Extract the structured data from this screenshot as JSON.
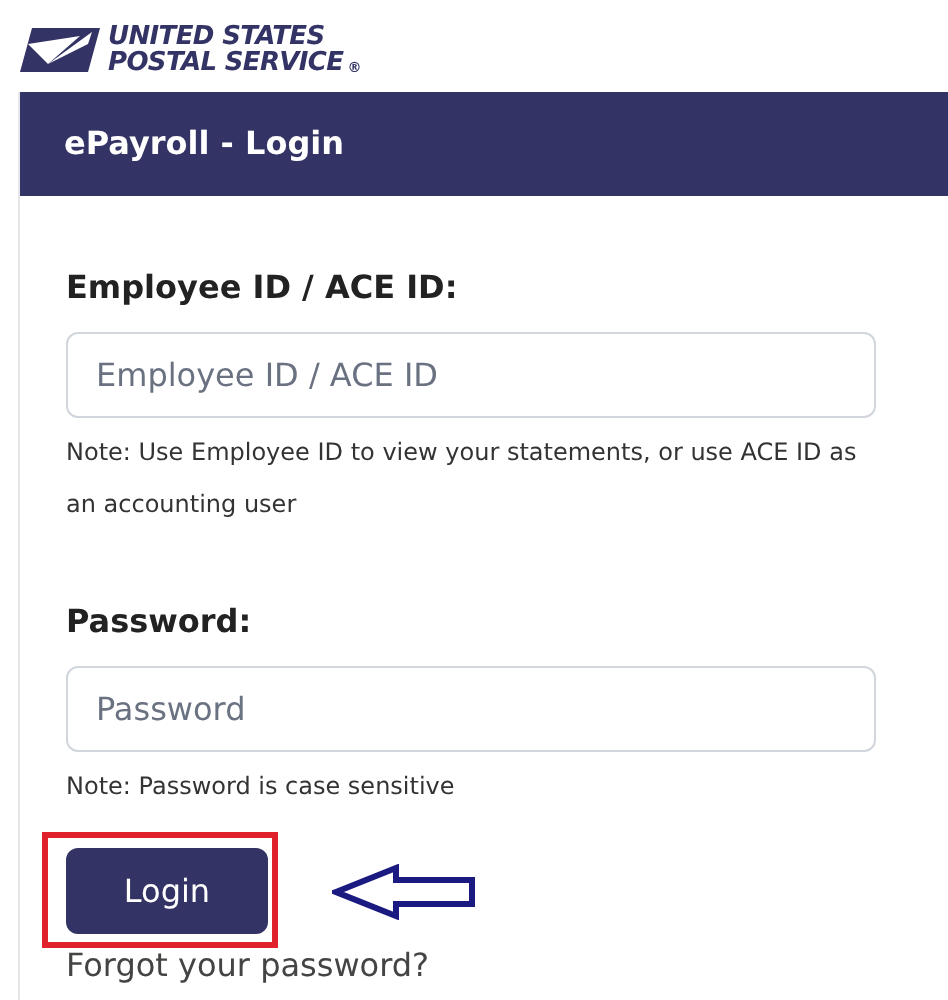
{
  "logo": {
    "line_1": "UNITED STATES",
    "line_2": "POSTAL SERVICE",
    "mark": "®"
  },
  "header": {
    "title": "ePayroll - Login"
  },
  "form": {
    "fields": [
      {
        "label": "Employee ID / ACE ID:",
        "placeholder": "Employee ID / ACE ID",
        "note": "Note: Use Employee ID to view your statements, or use ACE ID as an accounting user"
      },
      {
        "label": "Password:",
        "placeholder": "Password",
        "note": "Note: Password is case sensitive"
      }
    ],
    "submit": {
      "label": "Login",
      "highlighted": true
    },
    "link": "Forgot your password?"
  }
}
